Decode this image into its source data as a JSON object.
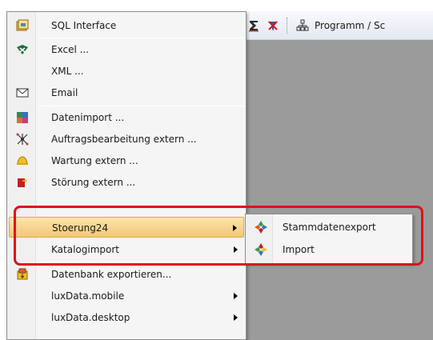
{
  "toolbar": {
    "program_button_label": "Programm / Sc"
  },
  "menu": {
    "items": [
      {
        "label": "SQL Interface",
        "icon": "sql-interface-icon"
      },
      {
        "label": "Excel ...",
        "icon": "excel-icon"
      },
      {
        "label": "XML ...",
        "icon": ""
      },
      {
        "label": "Email",
        "icon": "email-icon"
      },
      {
        "label": "Datenimport ...",
        "icon": "data-import-icon"
      },
      {
        "label": "Auftragsbearbeitung extern ...",
        "icon": "network-icon"
      },
      {
        "label": "Wartung extern ...",
        "icon": "helmet-icon"
      },
      {
        "label": "Störung extern ...",
        "icon": "fault-icon"
      },
      {
        "label": "Stoerung24",
        "has_submenu": true
      },
      {
        "label": "Katalogimport",
        "has_submenu": true
      },
      {
        "label": "Datenbank exportieren...",
        "icon": "database-export-icon"
      },
      {
        "label": "luxData.mobile",
        "has_submenu": true
      },
      {
        "label": "luxData.desktop",
        "has_submenu": true
      }
    ]
  },
  "submenu": {
    "items": [
      {
        "label": "Stammdatenexport",
        "icon": "master-data-export-icon"
      },
      {
        "label": "Import",
        "icon": "import-icon"
      }
    ]
  },
  "colors": {
    "highlight": "#f4c772",
    "annotation": "#e0101c",
    "workspace": "#9b9b9b"
  }
}
